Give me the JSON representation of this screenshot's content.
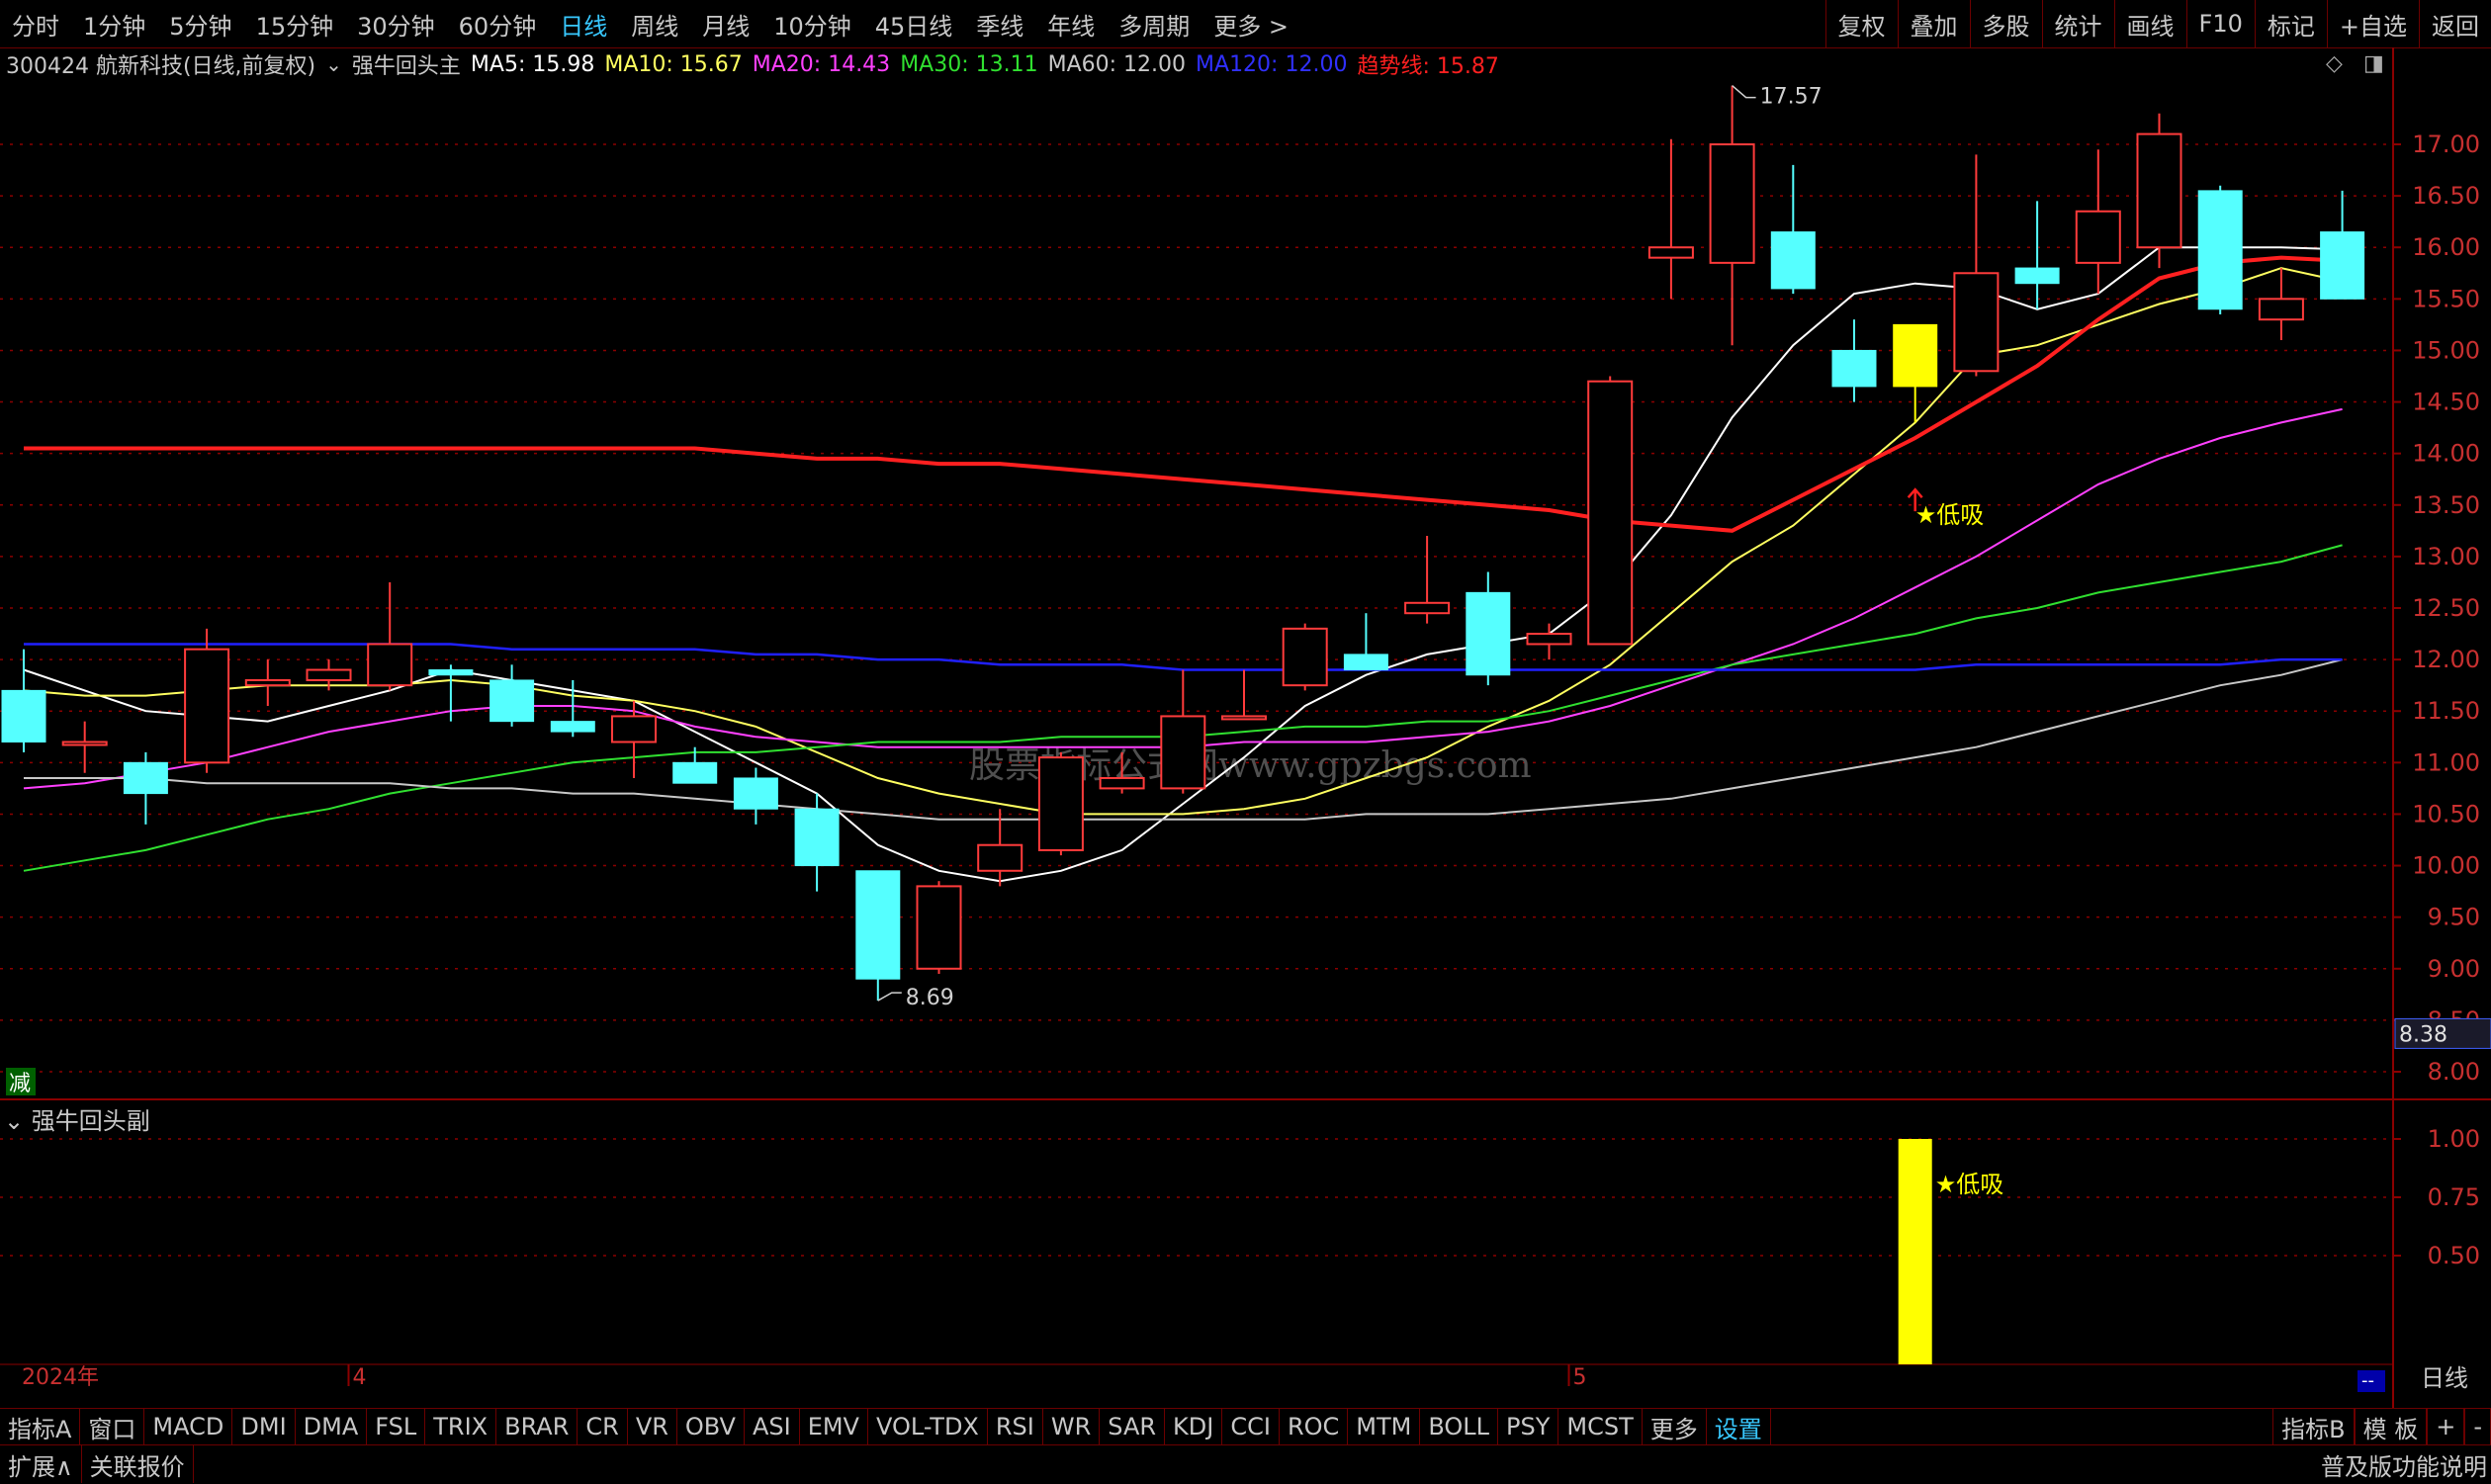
{
  "toolbar": {
    "tabs": [
      "分时",
      "1分钟",
      "5分钟",
      "15分钟",
      "30分钟",
      "60分钟",
      "日线",
      "周线",
      "月线",
      "10分钟",
      "45日线",
      "季线",
      "年线",
      "多周期",
      "更多 >"
    ],
    "active_tab": "日线",
    "right_buttons": [
      "复权",
      "叠加",
      "多股",
      "统计",
      "画线",
      "F10",
      "标记",
      "+自选",
      "返回"
    ]
  },
  "info": {
    "stock": "300424 航新科技(日线,前复权)",
    "indicator": "强牛回头主",
    "ma5": "MA5: 15.98",
    "ma10": "MA10: 15.67",
    "ma20": "MA20: 14.43",
    "ma30": "MA30: 13.11",
    "ma60": "MA60: 12.00",
    "ma120": "MA120: 12.00",
    "trend": "趋势线: 15.87"
  },
  "colors": {
    "up": "#ff3b3b",
    "down": "#55ffff",
    "ma5": "#ffffff",
    "ma10": "#ffff60",
    "ma20": "#ff40ff",
    "ma30": "#30e030",
    "ma60": "#c8c8c8",
    "ma120": "#2020ff",
    "trend": "#ff2020",
    "signal": "#ffff00",
    "grid": "#8b0000"
  },
  "chart_data": [
    {
      "type": "candlestick",
      "title": "300424 航新科技(日线,前复权)",
      "ylim": [
        7.8,
        17.6
      ],
      "yticks": [
        "17.00",
        "16.50",
        "16.00",
        "15.50",
        "15.00",
        "14.50",
        "14.00",
        "13.50",
        "13.00",
        "12.50",
        "12.00",
        "11.50",
        "11.00",
        "10.50",
        "10.00",
        "9.50",
        "9.00",
        "8.50",
        "8.00"
      ],
      "current_price_label": "8.38",
      "x_labels": [
        {
          "index": 5,
          "label": "4"
        },
        {
          "index": 25,
          "label": "5"
        }
      ],
      "year_label": "2024年",
      "candles": [
        {
          "o": 11.7,
          "h": 12.1,
          "l": 11.1,
          "c": 11.2
        },
        {
          "o": 11.2,
          "h": 11.4,
          "l": 10.9,
          "c": 11.2
        },
        {
          "o": 11.0,
          "h": 11.1,
          "l": 10.4,
          "c": 10.7
        },
        {
          "o": 11.0,
          "h": 12.3,
          "l": 10.9,
          "c": 12.1
        },
        {
          "o": 11.75,
          "h": 12.0,
          "l": 11.55,
          "c": 11.8
        },
        {
          "o": 11.8,
          "h": 12.0,
          "l": 11.7,
          "c": 11.9
        },
        {
          "o": 11.75,
          "h": 12.75,
          "l": 11.7,
          "c": 12.15
        },
        {
          "o": 11.9,
          "h": 11.95,
          "l": 11.4,
          "c": 11.85
        },
        {
          "o": 11.8,
          "h": 11.95,
          "l": 11.35,
          "c": 11.4
        },
        {
          "o": 11.4,
          "h": 11.8,
          "l": 11.25,
          "c": 11.3
        },
        {
          "o": 11.2,
          "h": 11.6,
          "l": 10.85,
          "c": 11.45
        },
        {
          "o": 11.0,
          "h": 11.15,
          "l": 10.8,
          "c": 10.8
        },
        {
          "o": 10.85,
          "h": 10.95,
          "l": 10.4,
          "c": 10.55
        },
        {
          "o": 10.55,
          "h": 10.7,
          "l": 9.75,
          "c": 10.0
        },
        {
          "o": 9.95,
          "h": 9.95,
          "l": 8.69,
          "c": 8.9
        },
        {
          "o": 9.0,
          "h": 9.85,
          "l": 8.95,
          "c": 9.8
        },
        {
          "o": 9.95,
          "h": 10.55,
          "l": 9.8,
          "c": 10.2
        },
        {
          "o": 10.15,
          "h": 11.1,
          "l": 10.1,
          "c": 11.05
        },
        {
          "o": 10.75,
          "h": 11.1,
          "l": 10.7,
          "c": 10.85
        },
        {
          "o": 10.75,
          "h": 11.9,
          "l": 10.7,
          "c": 11.45
        },
        {
          "o": 11.45,
          "h": 11.9,
          "l": 11.45,
          "c": 11.45
        },
        {
          "o": 11.75,
          "h": 12.35,
          "l": 11.7,
          "c": 12.3
        },
        {
          "o": 12.05,
          "h": 12.45,
          "l": 11.95,
          "c": 11.9
        },
        {
          "o": 12.45,
          "h": 13.2,
          "l": 12.35,
          "c": 12.55
        },
        {
          "o": 12.65,
          "h": 12.85,
          "l": 11.75,
          "c": 11.85
        },
        {
          "o": 12.15,
          "h": 12.35,
          "l": 12.0,
          "c": 12.25
        },
        {
          "o": 12.15,
          "h": 14.75,
          "l": 12.15,
          "c": 14.7
        },
        {
          "o": 15.9,
          "h": 17.05,
          "l": 15.5,
          "c": 16.0
        },
        {
          "o": 15.85,
          "h": 17.57,
          "l": 15.05,
          "c": 17.0
        },
        {
          "o": 16.15,
          "h": 16.8,
          "l": 15.55,
          "c": 15.6
        },
        {
          "o": 15.0,
          "h": 15.3,
          "l": 14.5,
          "c": 14.65
        },
        {
          "o": 14.65,
          "h": 15.25,
          "l": 14.3,
          "c": 15.25
        },
        {
          "o": 14.8,
          "h": 16.9,
          "l": 14.75,
          "c": 15.75
        },
        {
          "o": 15.8,
          "h": 16.45,
          "l": 15.4,
          "c": 15.65
        },
        {
          "o": 15.85,
          "h": 16.95,
          "l": 15.55,
          "c": 16.35
        },
        {
          "o": 16.0,
          "h": 17.3,
          "l": 15.8,
          "c": 17.1
        },
        {
          "o": 16.55,
          "h": 16.6,
          "l": 15.35,
          "c": 15.4
        },
        {
          "o": 15.3,
          "h": 15.8,
          "l": 15.1,
          "c": 15.5
        },
        {
          "o": 16.15,
          "h": 16.55,
          "l": 15.5,
          "c": 15.5
        }
      ],
      "series": [
        {
          "name": "MA5",
          "values": [
            11.9,
            11.7,
            11.5,
            11.45,
            11.4,
            11.55,
            11.7,
            11.9,
            11.8,
            11.7,
            11.6,
            11.3,
            11.0,
            10.7,
            10.2,
            9.95,
            9.85,
            9.95,
            10.15,
            10.6,
            11.05,
            11.55,
            11.85,
            12.05,
            12.15,
            12.25,
            12.7,
            13.4,
            14.35,
            15.05,
            15.55,
            15.65,
            15.6,
            15.4,
            15.55,
            16.0,
            16.0,
            16.0,
            15.98
          ]
        },
        {
          "name": "MA10",
          "values": [
            11.7,
            11.65,
            11.65,
            11.7,
            11.75,
            11.75,
            11.75,
            11.8,
            11.75,
            11.65,
            11.6,
            11.5,
            11.35,
            11.1,
            10.85,
            10.7,
            10.6,
            10.5,
            10.5,
            10.5,
            10.55,
            10.65,
            10.85,
            11.05,
            11.35,
            11.6,
            11.95,
            12.45,
            12.95,
            13.3,
            13.8,
            14.3,
            14.95,
            15.05,
            15.25,
            15.45,
            15.6,
            15.8,
            15.67
          ]
        },
        {
          "name": "MA20",
          "values": [
            10.75,
            10.8,
            10.9,
            11.0,
            11.15,
            11.3,
            11.4,
            11.5,
            11.55,
            11.55,
            11.5,
            11.35,
            11.25,
            11.2,
            11.15,
            11.15,
            11.15,
            11.15,
            11.15,
            11.15,
            11.2,
            11.2,
            11.2,
            11.25,
            11.3,
            11.4,
            11.55,
            11.75,
            11.95,
            12.15,
            12.4,
            12.7,
            13.0,
            13.35,
            13.7,
            13.95,
            14.15,
            14.3,
            14.43
          ]
        },
        {
          "name": "MA30",
          "values": [
            9.95,
            10.05,
            10.15,
            10.3,
            10.45,
            10.55,
            10.7,
            10.8,
            10.9,
            11.0,
            11.05,
            11.1,
            11.1,
            11.15,
            11.2,
            11.2,
            11.2,
            11.25,
            11.25,
            11.25,
            11.3,
            11.35,
            11.35,
            11.4,
            11.4,
            11.5,
            11.65,
            11.8,
            11.95,
            12.05,
            12.15,
            12.25,
            12.4,
            12.5,
            12.65,
            12.75,
            12.85,
            12.95,
            13.11
          ]
        },
        {
          "name": "MA60",
          "values": [
            10.85,
            10.85,
            10.85,
            10.8,
            10.8,
            10.8,
            10.8,
            10.75,
            10.75,
            10.7,
            10.7,
            10.65,
            10.6,
            10.55,
            10.5,
            10.45,
            10.45,
            10.45,
            10.45,
            10.45,
            10.45,
            10.45,
            10.5,
            10.5,
            10.5,
            10.55,
            10.6,
            10.65,
            10.75,
            10.85,
            10.95,
            11.05,
            11.15,
            11.3,
            11.45,
            11.6,
            11.75,
            11.85,
            12.0
          ]
        },
        {
          "name": "MA120",
          "values": [
            12.15,
            12.15,
            12.15,
            12.15,
            12.15,
            12.15,
            12.15,
            12.15,
            12.1,
            12.1,
            12.1,
            12.1,
            12.05,
            12.05,
            12.0,
            12.0,
            11.95,
            11.95,
            11.95,
            11.9,
            11.9,
            11.9,
            11.9,
            11.9,
            11.9,
            11.9,
            11.9,
            11.9,
            11.9,
            11.9,
            11.9,
            11.9,
            11.95,
            11.95,
            11.95,
            11.95,
            11.95,
            12.0,
            12.0
          ]
        },
        {
          "name": "趋势线",
          "values": [
            14.05,
            14.05,
            14.05,
            14.05,
            14.05,
            14.05,
            14.05,
            14.05,
            14.05,
            14.05,
            14.05,
            14.05,
            14.0,
            13.95,
            13.95,
            13.9,
            13.9,
            13.85,
            13.8,
            13.75,
            13.7,
            13.65,
            13.6,
            13.55,
            13.5,
            13.45,
            13.35,
            13.3,
            13.25,
            13.55,
            13.85,
            14.15,
            14.5,
            14.85,
            15.3,
            15.7,
            15.85,
            15.9,
            15.87
          ]
        }
      ],
      "highlight_index": 31,
      "annotations": [
        {
          "label": "17.57",
          "index": 28,
          "value": 17.57
        },
        {
          "label": "8.69",
          "index": 14,
          "value": 8.69
        },
        {
          "label": "★低吸",
          "index": 31,
          "value": 13.4
        }
      ],
      "watermark": "股票指标公式网www.gpzbgs.com",
      "minus_label": "减"
    },
    {
      "type": "bar",
      "title": "强牛回头副",
      "ylim": [
        0,
        1.0
      ],
      "yticks": [
        "1.00",
        "0.75",
        "0.50"
      ],
      "bars": [
        {
          "index": 31,
          "value": 1.0,
          "label": "★低吸"
        }
      ]
    }
  ],
  "bottombar1": {
    "left": [
      "指标A",
      "窗口",
      "MACD",
      "DMI",
      "DMA",
      "FSL",
      "TRIX",
      "BRAR",
      "CR",
      "VR",
      "OBV",
      "ASI",
      "EMV",
      "VOL-TDX",
      "RSI",
      "WR",
      "SAR",
      "KDJ",
      "CCI",
      "ROC",
      "MTM",
      "BOLL",
      "PSY",
      "MCST",
      "更多",
      "设置"
    ],
    "active": "设置",
    "right": [
      "指标B",
      "模 板",
      "+",
      "-"
    ]
  },
  "bottombar2": {
    "left": [
      "扩展∧",
      "关联报价"
    ],
    "right": "普及版功能说明"
  },
  "side_period_label": "日线",
  "scroll_marker": "--"
}
